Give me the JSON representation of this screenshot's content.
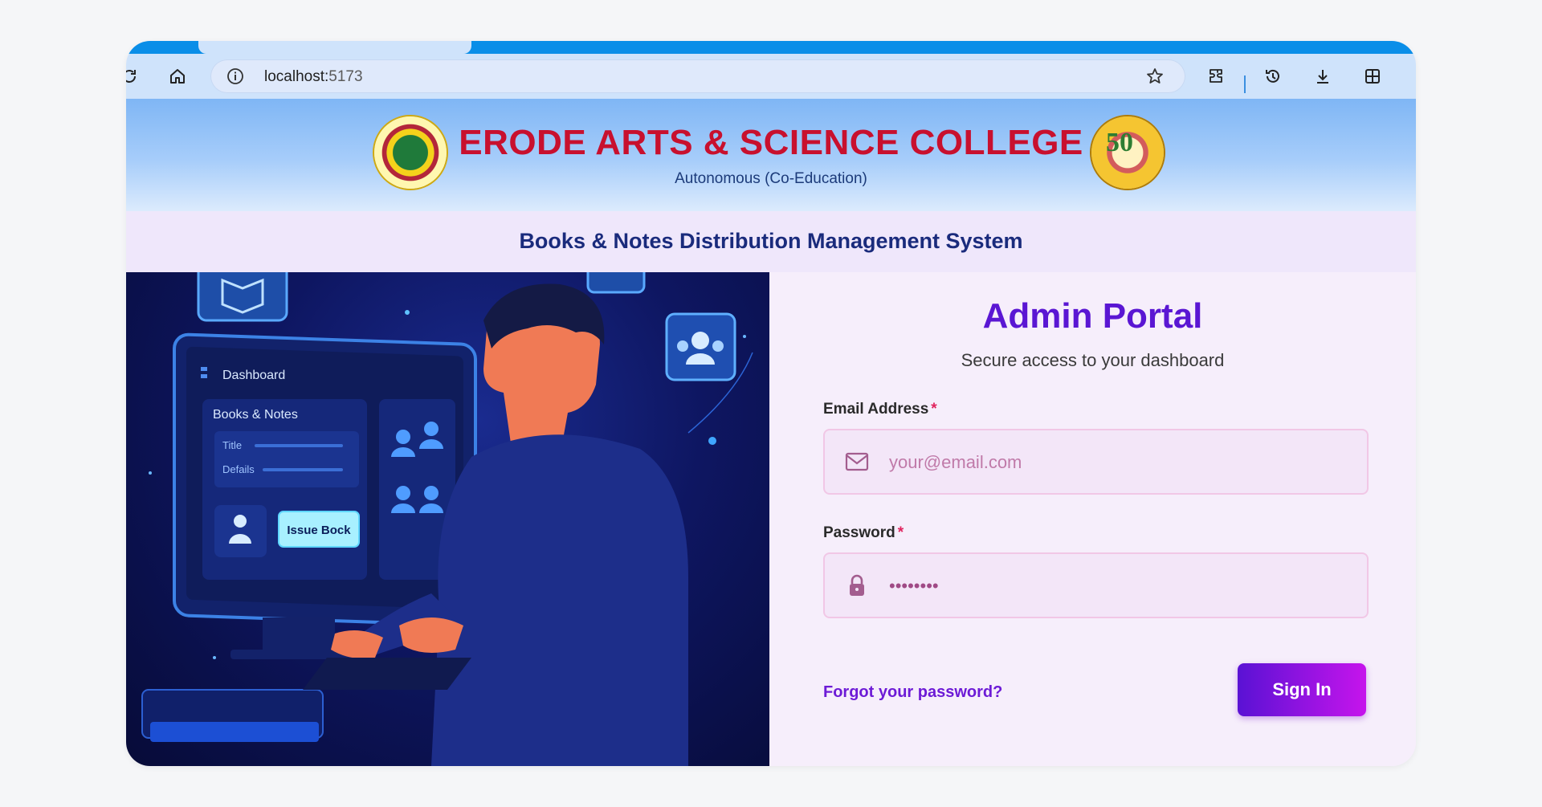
{
  "browser": {
    "url_host": "localhost:",
    "url_port": "5173"
  },
  "banner": {
    "college_name": "ERODE ARTS & SCIENCE COLLEGE",
    "college_subtitle": "Autonomous (Co-Education)",
    "system_title": "Books & Notes Distribution Management System"
  },
  "illustration": {
    "dashboard_label": "Dashboard",
    "books_label": "Books & Notes",
    "title_label": "Title",
    "details_label": "Defails",
    "issue_button": "Issue Bock"
  },
  "login": {
    "title": "Admin Portal",
    "subtitle": "Secure access to your dashboard",
    "email_label": "Email Address",
    "email_placeholder": "your@email.com",
    "password_label": "Password",
    "password_value": "••••••••",
    "required_mark": "*",
    "forgot_link": "Forgot your password?",
    "signin_button": "Sign In"
  },
  "colors": {
    "accent": "#5a16d3",
    "brand_red": "#c8102e",
    "button_gradient_end": "#c614ec"
  },
  "icons": [
    "reload-icon",
    "home-icon",
    "info-icon",
    "star-icon",
    "extensions-icon",
    "history-icon",
    "download-icon",
    "collections-icon",
    "mail-icon",
    "lock-icon"
  ]
}
